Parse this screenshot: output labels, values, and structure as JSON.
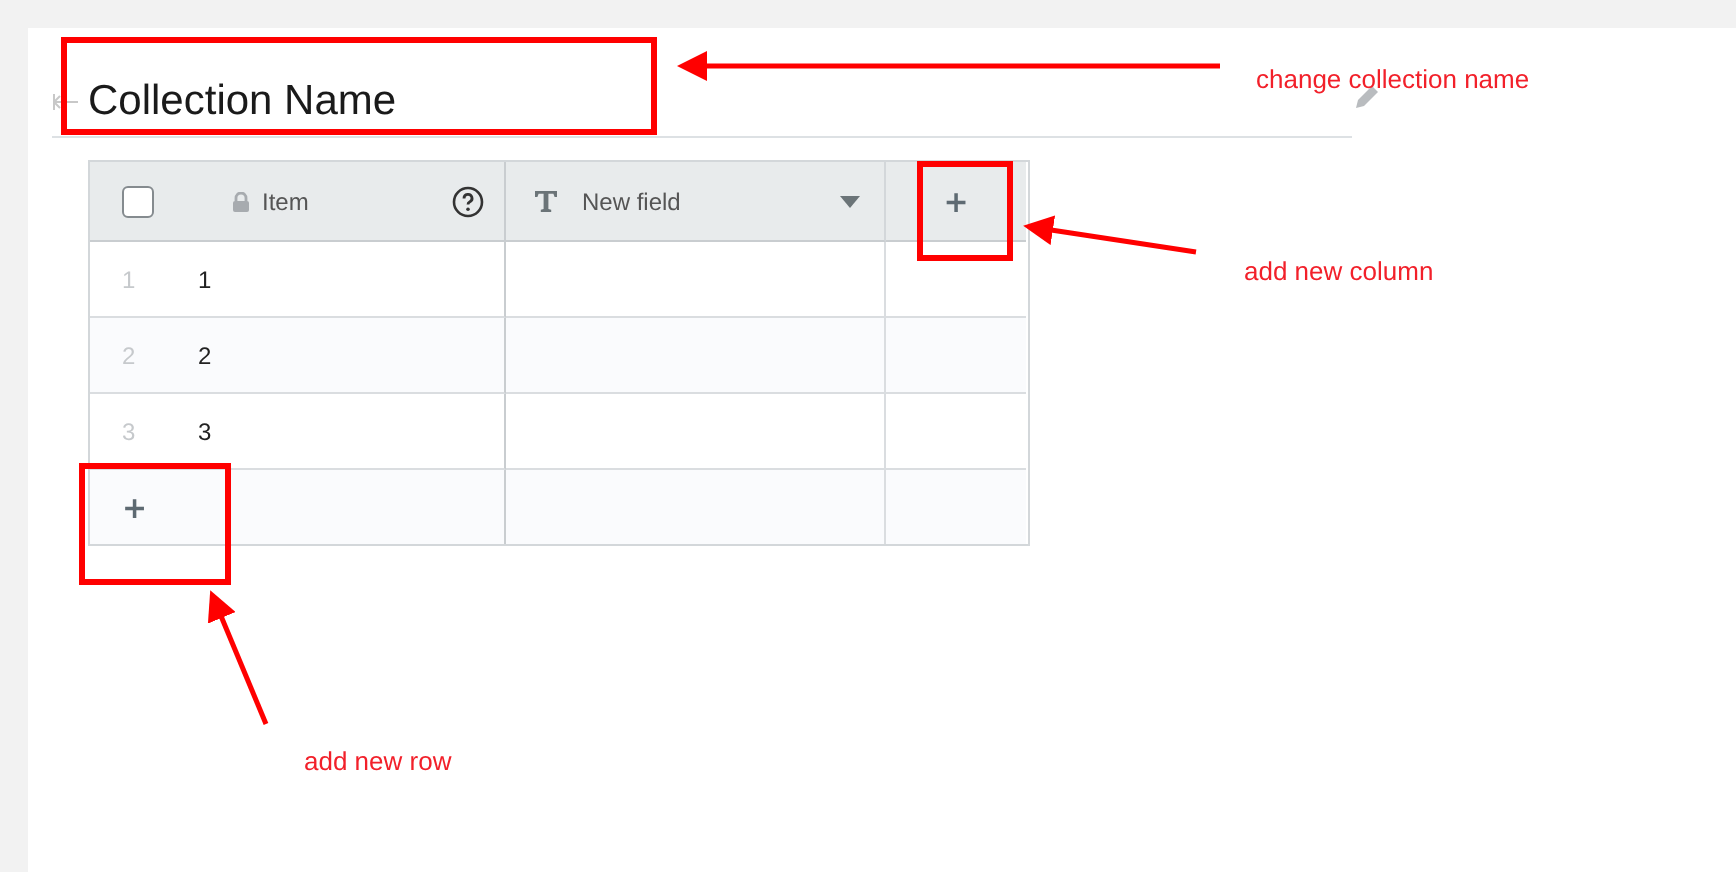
{
  "collection": {
    "title": "Collection Name"
  },
  "table": {
    "select_all": {
      "checked": false
    },
    "columns": [
      {
        "label": "Item",
        "kind": "locked"
      },
      {
        "label": "New field",
        "kind": "text"
      }
    ],
    "add_column": "+",
    "rows": [
      {
        "number": "1",
        "item": "1"
      },
      {
        "number": "2",
        "item": "2"
      },
      {
        "number": "3",
        "item": "3"
      }
    ],
    "add_row": "+"
  },
  "annotations": [
    {
      "label": "change collection name"
    },
    {
      "label": "add new column"
    },
    {
      "label": "add new row"
    }
  ]
}
